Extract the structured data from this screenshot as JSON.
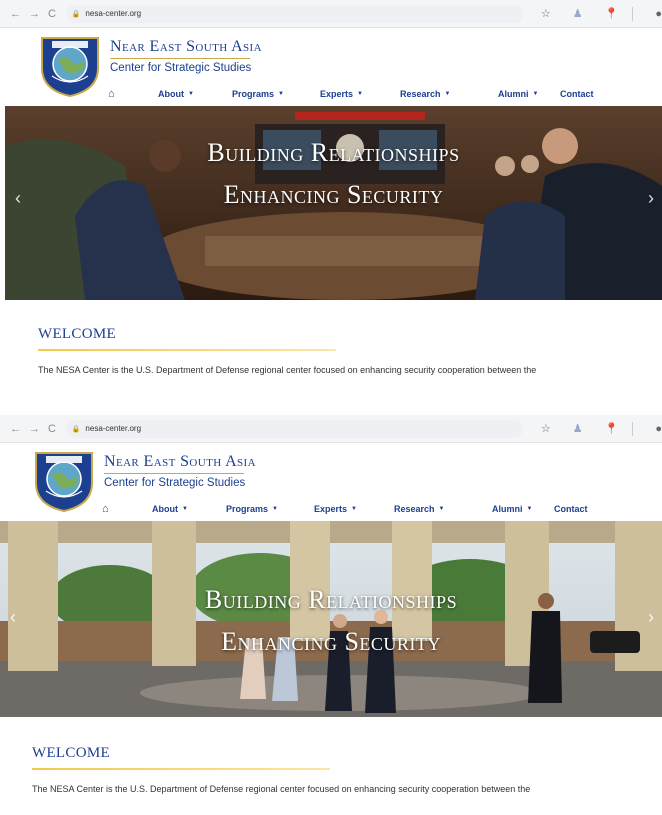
{
  "browser": {
    "url": "nesa-center.org",
    "icons": [
      "back-icon",
      "forward-icon",
      "reload-icon",
      "lock-icon",
      "star-icon",
      "extension-icon",
      "pin-icon",
      "account-icon"
    ]
  },
  "site": {
    "name": "Near East South Asia",
    "subtitle": "Center for Strategic Studies",
    "menu": [
      {
        "label": "About",
        "caret": true
      },
      {
        "label": "Programs",
        "caret": true
      },
      {
        "label": "Experts",
        "caret": true
      },
      {
        "label": "Research",
        "caret": true
      },
      {
        "label": "Alumni",
        "caret": true
      },
      {
        "label": "Contact",
        "caret": false
      }
    ],
    "home_icon": "home-icon"
  },
  "slides": [
    {
      "line1": "Building Relationships",
      "line2": "Enhancing Security"
    },
    {
      "line1": "Building Relationships",
      "line2": "Enhancing Security"
    }
  ],
  "welcome": {
    "title": "WELCOME",
    "text": "The NESA Center is the U.S. Department of Defense regional center focused on enhancing security cooperation between the"
  },
  "colors": {
    "brand": "#1d3f8f",
    "gold": "#c9a94a",
    "underline": "#f2c94c"
  }
}
